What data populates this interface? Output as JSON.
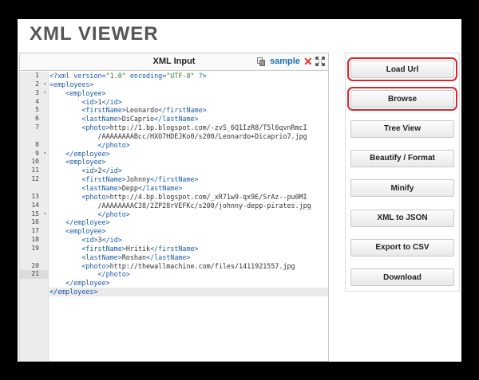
{
  "app": {
    "title": "XML VIEWER"
  },
  "editor": {
    "title": "XML Input",
    "sample_label": "sample",
    "clear_symbol": "✕",
    "line_numbers": [
      "1",
      "2",
      "3",
      "4",
      "5",
      "6",
      "7",
      "",
      "8",
      "9",
      "10",
      "11",
      "12",
      "",
      "13",
      "14",
      "15",
      "16",
      "17",
      "18",
      "19",
      "",
      "20",
      "21"
    ],
    "lines": [
      "<?xml version=\"1.0\" encoding=\"UTF-8\" ?>",
      "<employees>",
      "    <employee>",
      "        <id>1</id>",
      "        <firstName>Leonardo</firstName>",
      "        <lastName>DiCaprio</lastName>",
      "        <photo>http://1.bp.blogspot.com/-zvS_6Q1IzR8/T5l6qvnRmcI",
      "            /AAAAAAAABcc/HXO7HDEJKo0/s200/Leonardo+Dicaprio7.jpg",
      "            </photo>",
      "    </employee>",
      "    <employee>",
      "        <id>2</id>",
      "        <firstName>Johnny</firstName>",
      "        <lastName>Depp</lastName>",
      "        <photo>http://4.bp.blogspot.com/_xR71w9-qx9E/SrAz--pu0MI",
      "            /AAAAAAAAC38/2ZP28rVEFKc/s200/johnny-depp-pirates.jpg",
      "            </photo>",
      "    </employee>",
      "    <employee>",
      "        <id>3</id>",
      "        <firstName>Hritik</firstName>",
      "        <lastName>Roshan</lastName>",
      "        <photo>http://thewallmachine.com/files/1411921557.jpg",
      "            </photo>",
      "    </employee>",
      "</employees>"
    ]
  },
  "actions": [
    {
      "id": "load-url",
      "label": "Load Url",
      "highlighted": true
    },
    {
      "id": "browse",
      "label": "Browse",
      "highlighted": true
    },
    {
      "id": "tree-view",
      "label": "Tree View",
      "highlighted": false
    },
    {
      "id": "beautify",
      "label": "Beautify / Format",
      "highlighted": false
    },
    {
      "id": "minify",
      "label": "Minify",
      "highlighted": false
    },
    {
      "id": "xml-to-json",
      "label": "XML to JSON",
      "highlighted": false
    },
    {
      "id": "export-csv",
      "label": "Export to CSV",
      "highlighted": false
    },
    {
      "id": "download",
      "label": "Download",
      "highlighted": false
    }
  ],
  "colors": {
    "highlight": "#d7262e",
    "link": "#1a6fb5",
    "tag": "#1a5aa8",
    "string": "#2e7d32"
  }
}
